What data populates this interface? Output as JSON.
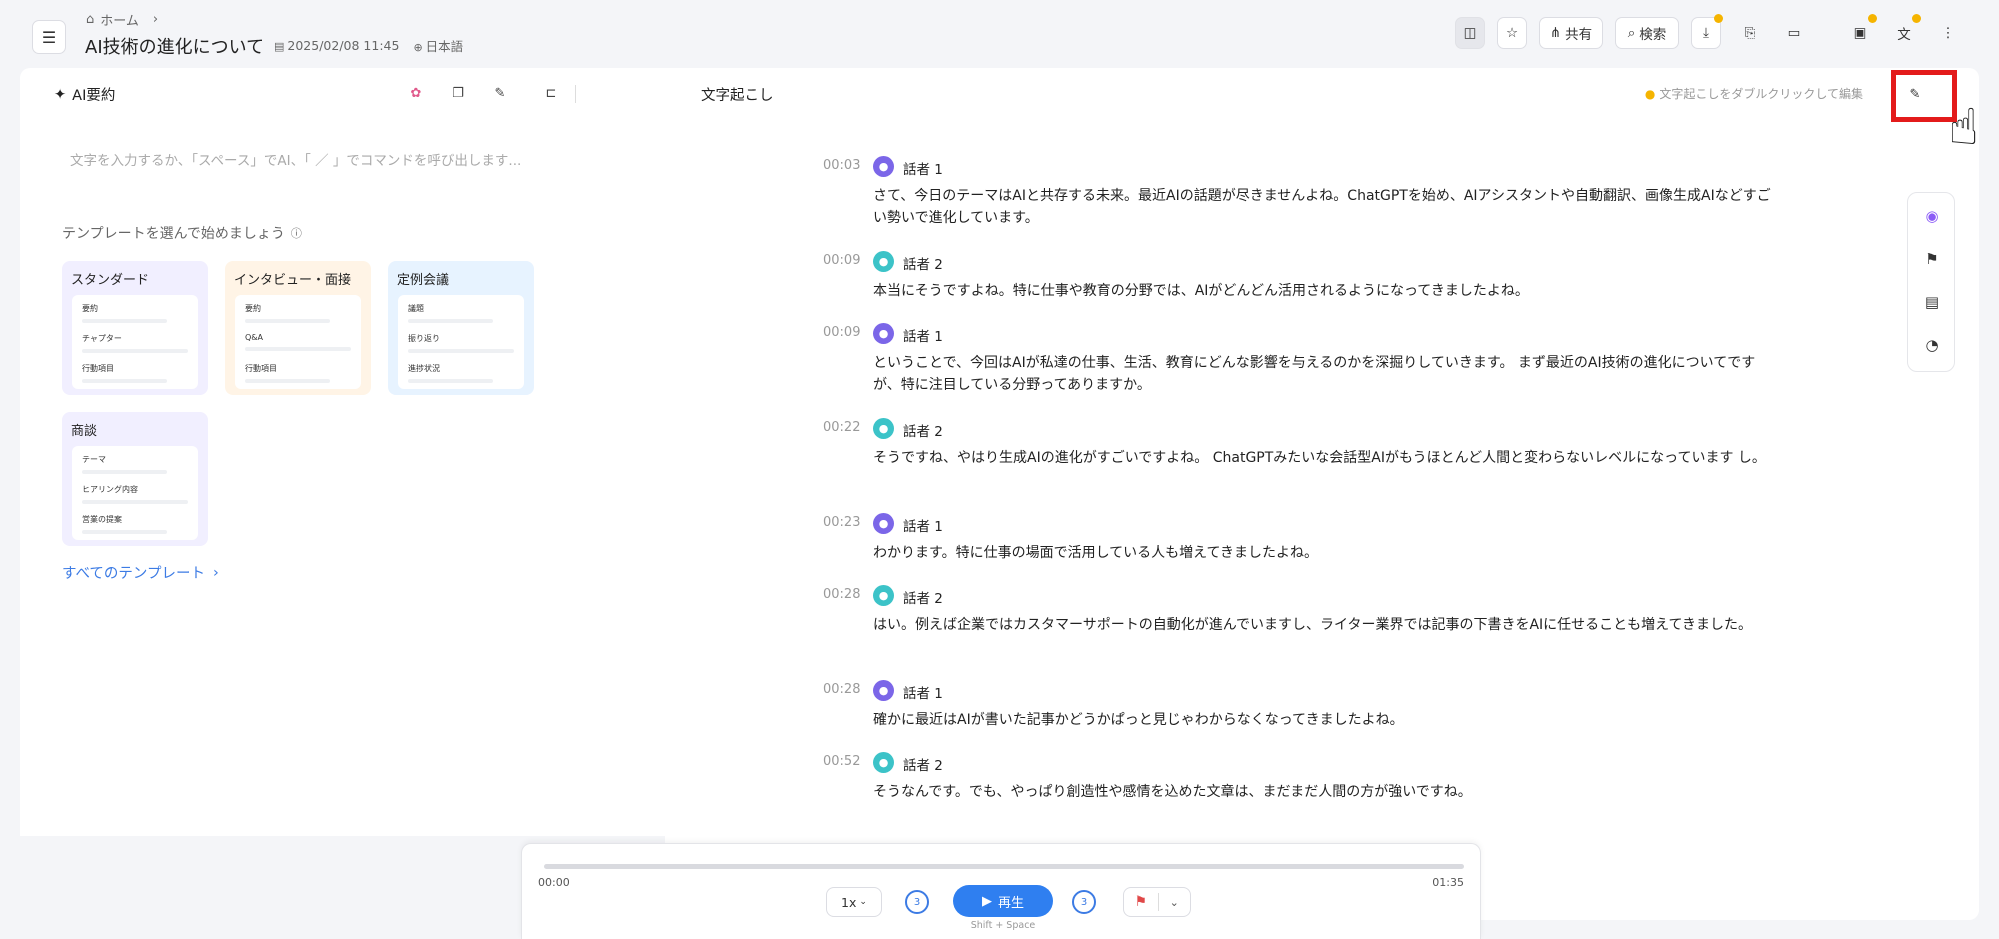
{
  "header": {
    "menu_icon": "hamburger-menu-icon",
    "breadcrumb_home": "ホーム",
    "breadcrumb_chevron": "›",
    "title": "AI技術の進化について",
    "date": "2025/02/08 11:45",
    "language": "日本語",
    "toolbar": {
      "share_label": "共有",
      "search_label": "検索"
    }
  },
  "left_panel": {
    "title": "AI要約",
    "input_placeholder": "文字を入力するか、「スペース」でAI、「 ／ 」でコマンドを呼び出します...",
    "template_heading": "テンプレートを選んで始めましょう",
    "templates": [
      {
        "name": "スタンダード",
        "color": "#f1efff",
        "items": [
          "要約",
          "チャプター",
          "行動項目"
        ]
      },
      {
        "name": "インタビュー・面接",
        "color": "#fff4e6",
        "items": [
          "要約",
          "Q&A",
          "行動項目"
        ]
      },
      {
        "name": "定例会議",
        "color": "#e7f3ff",
        "items": [
          "議題",
          "振り返り",
          "進捗状況"
        ]
      },
      {
        "name": "商談",
        "color": "#f1efff",
        "items": [
          "テーマ",
          "ヒアリング内容",
          "営業の提案"
        ]
      }
    ],
    "all_templates_link": "すべてのテンプレート"
  },
  "right_panel": {
    "title": "文字起こし",
    "hint": "文字起こしをダブルクリックして編集",
    "entries": [
      {
        "time": "00:03",
        "speaker": "話者 1",
        "text": "さて、今日のテーマはAIと共存する未来。最近AIの話題が尽きませんよね。ChatGPTを始め、AIアシスタントや自動翻訳、画像生成AIなどすごい勢いで進化しています。"
      },
      {
        "time": "00:09",
        "speaker": "話者 2",
        "text": "本当にそうですよね。特に仕事や教育の分野では、AIがどんどん活用されるようになってきましたよね。"
      },
      {
        "time": "00:09",
        "speaker": "話者 1",
        "text": "ということで、今回はAIが私達の仕事、生活、教育にどんな影響を与えるのかを深掘りしていきます。 まず最近のAI技術の進化についてですが、特に注目している分野ってありますか。"
      },
      {
        "time": "00:22",
        "speaker": "話者 2",
        "text": "そうですね、やはり生成AIの進化がすごいですよね。 ChatGPTみたいな会話型AIがもうほとんど人間と変わらないレベルになっています し。"
      },
      {
        "time": "00:23",
        "speaker": "話者 1",
        "text": "わかります。特に仕事の場面で活用している人も増えてきましたよね。"
      },
      {
        "time": "00:28",
        "speaker": "話者 2",
        "text": "はい。例えば企業ではカスタマーサポートの自動化が進んでいますし、ライター業界では記事の下書きをAIに任せることも増えてきました。"
      },
      {
        "time": "00:28",
        "speaker": "話者 1",
        "text": "確かに最近はAIが書いた記事かどうかぱっと見じゃわからなくなってきましたよね。"
      },
      {
        "time": "00:52",
        "speaker": "話者 2",
        "text": "そうなんです。でも、やっぱり創造性や感情を込めた文章は、まだまだ人間の方が強いですね。"
      }
    ],
    "speaker_colors": {
      "話者 1": "#7b66e8",
      "話者 2": "#3cc3c8"
    }
  },
  "player": {
    "current_time": "00:00",
    "total_time": "01:35",
    "speed": "1x",
    "skip_seconds": "3",
    "play_label": "再生",
    "shortcut": "Shift + Space"
  }
}
